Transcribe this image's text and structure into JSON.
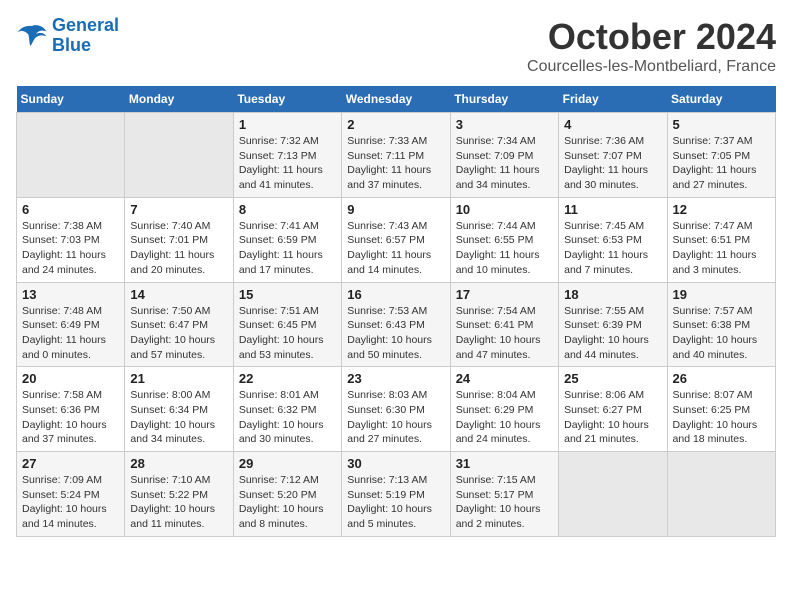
{
  "header": {
    "logo_line1": "General",
    "logo_line2": "Blue",
    "month": "October 2024",
    "location": "Courcelles-les-Montbeliard, France"
  },
  "weekdays": [
    "Sunday",
    "Monday",
    "Tuesday",
    "Wednesday",
    "Thursday",
    "Friday",
    "Saturday"
  ],
  "weeks": [
    [
      {
        "day": "",
        "info": ""
      },
      {
        "day": "",
        "info": ""
      },
      {
        "day": "1",
        "info": "Sunrise: 7:32 AM\nSunset: 7:13 PM\nDaylight: 11 hours and 41 minutes."
      },
      {
        "day": "2",
        "info": "Sunrise: 7:33 AM\nSunset: 7:11 PM\nDaylight: 11 hours and 37 minutes."
      },
      {
        "day": "3",
        "info": "Sunrise: 7:34 AM\nSunset: 7:09 PM\nDaylight: 11 hours and 34 minutes."
      },
      {
        "day": "4",
        "info": "Sunrise: 7:36 AM\nSunset: 7:07 PM\nDaylight: 11 hours and 30 minutes."
      },
      {
        "day": "5",
        "info": "Sunrise: 7:37 AM\nSunset: 7:05 PM\nDaylight: 11 hours and 27 minutes."
      }
    ],
    [
      {
        "day": "6",
        "info": "Sunrise: 7:38 AM\nSunset: 7:03 PM\nDaylight: 11 hours and 24 minutes."
      },
      {
        "day": "7",
        "info": "Sunrise: 7:40 AM\nSunset: 7:01 PM\nDaylight: 11 hours and 20 minutes."
      },
      {
        "day": "8",
        "info": "Sunrise: 7:41 AM\nSunset: 6:59 PM\nDaylight: 11 hours and 17 minutes."
      },
      {
        "day": "9",
        "info": "Sunrise: 7:43 AM\nSunset: 6:57 PM\nDaylight: 11 hours and 14 minutes."
      },
      {
        "day": "10",
        "info": "Sunrise: 7:44 AM\nSunset: 6:55 PM\nDaylight: 11 hours and 10 minutes."
      },
      {
        "day": "11",
        "info": "Sunrise: 7:45 AM\nSunset: 6:53 PM\nDaylight: 11 hours and 7 minutes."
      },
      {
        "day": "12",
        "info": "Sunrise: 7:47 AM\nSunset: 6:51 PM\nDaylight: 11 hours and 3 minutes."
      }
    ],
    [
      {
        "day": "13",
        "info": "Sunrise: 7:48 AM\nSunset: 6:49 PM\nDaylight: 11 hours and 0 minutes."
      },
      {
        "day": "14",
        "info": "Sunrise: 7:50 AM\nSunset: 6:47 PM\nDaylight: 10 hours and 57 minutes."
      },
      {
        "day": "15",
        "info": "Sunrise: 7:51 AM\nSunset: 6:45 PM\nDaylight: 10 hours and 53 minutes."
      },
      {
        "day": "16",
        "info": "Sunrise: 7:53 AM\nSunset: 6:43 PM\nDaylight: 10 hours and 50 minutes."
      },
      {
        "day": "17",
        "info": "Sunrise: 7:54 AM\nSunset: 6:41 PM\nDaylight: 10 hours and 47 minutes."
      },
      {
        "day": "18",
        "info": "Sunrise: 7:55 AM\nSunset: 6:39 PM\nDaylight: 10 hours and 44 minutes."
      },
      {
        "day": "19",
        "info": "Sunrise: 7:57 AM\nSunset: 6:38 PM\nDaylight: 10 hours and 40 minutes."
      }
    ],
    [
      {
        "day": "20",
        "info": "Sunrise: 7:58 AM\nSunset: 6:36 PM\nDaylight: 10 hours and 37 minutes."
      },
      {
        "day": "21",
        "info": "Sunrise: 8:00 AM\nSunset: 6:34 PM\nDaylight: 10 hours and 34 minutes."
      },
      {
        "day": "22",
        "info": "Sunrise: 8:01 AM\nSunset: 6:32 PM\nDaylight: 10 hours and 30 minutes."
      },
      {
        "day": "23",
        "info": "Sunrise: 8:03 AM\nSunset: 6:30 PM\nDaylight: 10 hours and 27 minutes."
      },
      {
        "day": "24",
        "info": "Sunrise: 8:04 AM\nSunset: 6:29 PM\nDaylight: 10 hours and 24 minutes."
      },
      {
        "day": "25",
        "info": "Sunrise: 8:06 AM\nSunset: 6:27 PM\nDaylight: 10 hours and 21 minutes."
      },
      {
        "day": "26",
        "info": "Sunrise: 8:07 AM\nSunset: 6:25 PM\nDaylight: 10 hours and 18 minutes."
      }
    ],
    [
      {
        "day": "27",
        "info": "Sunrise: 7:09 AM\nSunset: 5:24 PM\nDaylight: 10 hours and 14 minutes."
      },
      {
        "day": "28",
        "info": "Sunrise: 7:10 AM\nSunset: 5:22 PM\nDaylight: 10 hours and 11 minutes."
      },
      {
        "day": "29",
        "info": "Sunrise: 7:12 AM\nSunset: 5:20 PM\nDaylight: 10 hours and 8 minutes."
      },
      {
        "day": "30",
        "info": "Sunrise: 7:13 AM\nSunset: 5:19 PM\nDaylight: 10 hours and 5 minutes."
      },
      {
        "day": "31",
        "info": "Sunrise: 7:15 AM\nSunset: 5:17 PM\nDaylight: 10 hours and 2 minutes."
      },
      {
        "day": "",
        "info": ""
      },
      {
        "day": "",
        "info": ""
      }
    ]
  ]
}
